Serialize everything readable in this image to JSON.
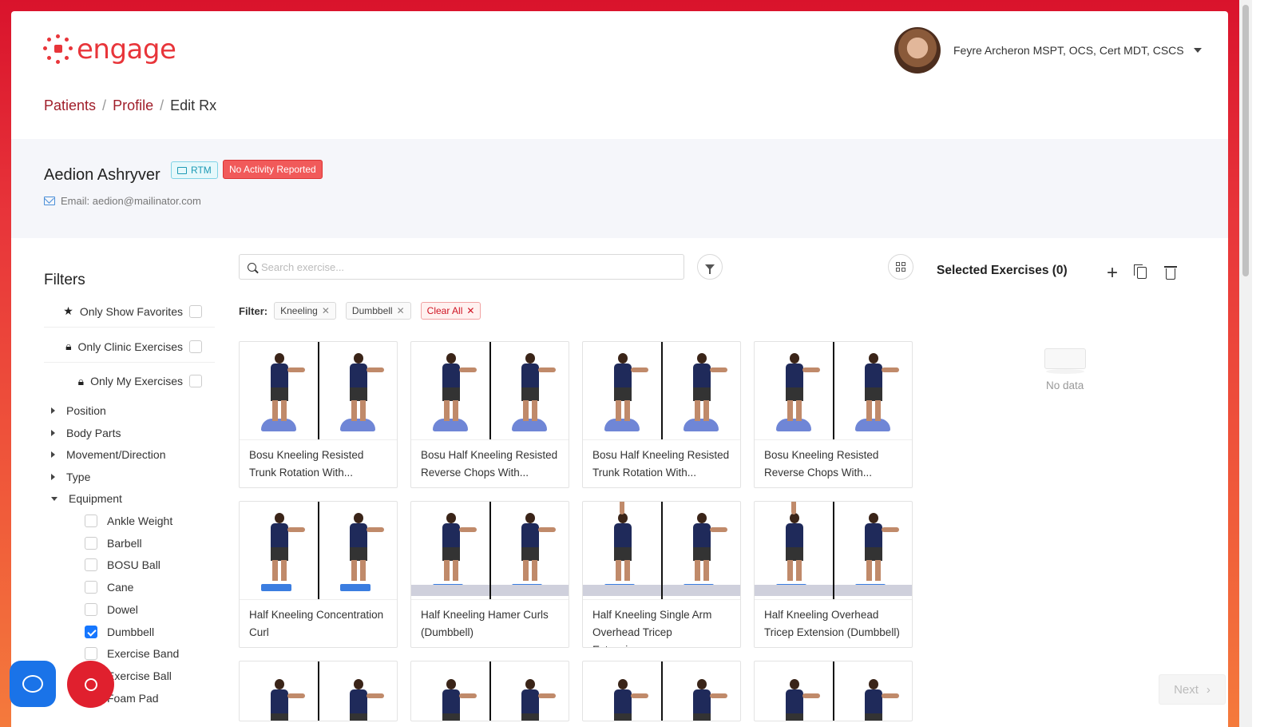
{
  "app": {
    "logo_text": "engage",
    "brand_color": "#e8353a"
  },
  "user": {
    "name": "Feyre Archeron MSPT, OCS, Cert MDT, CSCS"
  },
  "breadcrumb": {
    "patients": "Patients",
    "profile": "Profile",
    "current": "Edit Rx",
    "sep": "/"
  },
  "patient": {
    "name": "Aedion Ashryver",
    "rtm_badge": "RTM",
    "activity_badge": "No Activity Reported",
    "email": "Email: aedion@mailinator.com"
  },
  "filters": {
    "title": "Filters",
    "only_favorites": "Only Show Favorites",
    "only_clinic": "Only Clinic Exercises",
    "only_mine": "Only My Exercises",
    "categories": [
      "Position",
      "Body Parts",
      "Movement/Direction",
      "Type",
      "Equipment"
    ],
    "equipment": [
      {
        "label": "Ankle Weight",
        "checked": false
      },
      {
        "label": "Barbell",
        "checked": false
      },
      {
        "label": "BOSU Ball",
        "checked": false
      },
      {
        "label": "Cane",
        "checked": false
      },
      {
        "label": "Dowel",
        "checked": false
      },
      {
        "label": "Dumbbell",
        "checked": true
      },
      {
        "label": "Exercise Band",
        "checked": false
      },
      {
        "label": "Exercise Ball",
        "checked": false
      },
      {
        "label": "Foam Pad",
        "checked": false
      }
    ]
  },
  "search": {
    "placeholder": "Search exercise..."
  },
  "active_filters": {
    "label": "Filter:",
    "tags": [
      "Kneeling",
      "Dumbbell"
    ],
    "clear_all": "Clear All"
  },
  "exercises": [
    {
      "title": "Bosu Kneeling Resisted Trunk Rotation With...",
      "prop": "bosu"
    },
    {
      "title": "Bosu Half Kneeling Resisted Reverse Chops With...",
      "prop": "bosu"
    },
    {
      "title": "Bosu Half Kneeling Resisted Trunk Rotation With...",
      "prop": "bosu"
    },
    {
      "title": "Bosu Kneeling Resisted Reverse Chops With...",
      "prop": "bosu"
    },
    {
      "title": "Half Kneeling Concentration Curl",
      "prop": "pad"
    },
    {
      "title": "Half Kneeling Hamer Curls (Dumbbell)",
      "prop": "mat"
    },
    {
      "title": "Half Kneeling Single Arm Overhead Tricep Extension...",
      "prop": "mat"
    },
    {
      "title": "Half Kneeling Overhead Tricep Extension (Dumbbell)",
      "prop": "mat"
    }
  ],
  "selected": {
    "title": "Selected Exercises (0)",
    "empty": "No data"
  },
  "footer": {
    "next": "Next"
  }
}
